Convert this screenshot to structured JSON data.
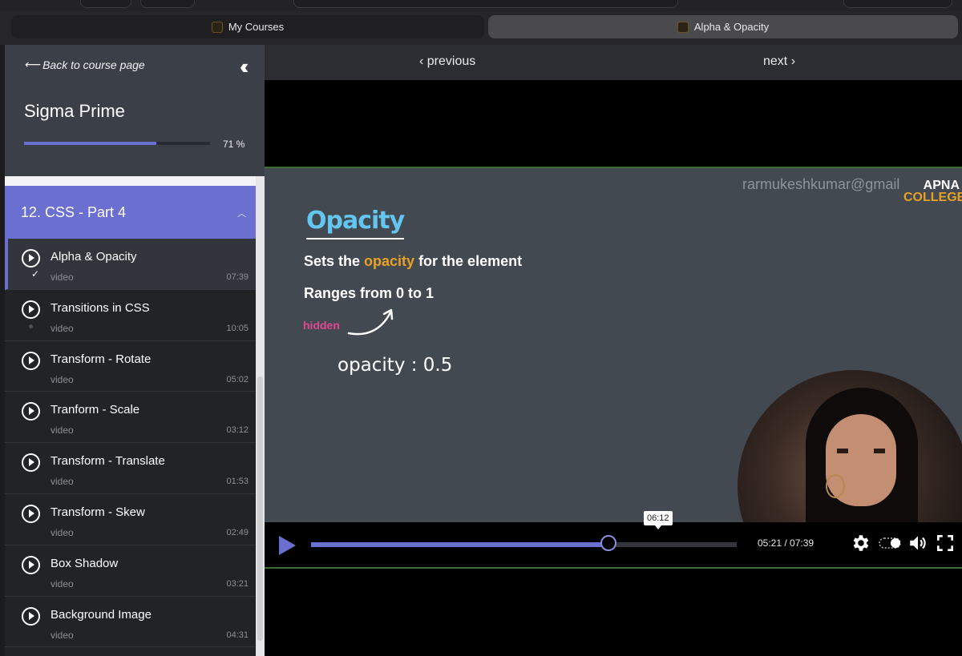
{
  "tabs": [
    {
      "label": "My Courses",
      "active": false
    },
    {
      "label": "Alpha & Opacity",
      "active": true
    }
  ],
  "sidebar": {
    "back_label": "Back to course page",
    "collapse_icon": "double-chevron-left-icon",
    "course_title": "Sigma Prime",
    "progress_percent": 71,
    "progress_label": "71 %",
    "section_title": "12. CSS - Part 4",
    "lessons": [
      {
        "title": "Alpha & Opacity",
        "type": "video",
        "duration": "07:39",
        "status": "completed",
        "current": true
      },
      {
        "title": "Transitions in CSS",
        "type": "video",
        "duration": "10:05",
        "status": "in-progress",
        "current": false
      },
      {
        "title": "Transform - Rotate",
        "type": "video",
        "duration": "05:02",
        "status": "",
        "current": false
      },
      {
        "title": "Tranform - Scale",
        "type": "video",
        "duration": "03:12",
        "status": "",
        "current": false
      },
      {
        "title": "Transform - Translate",
        "type": "video",
        "duration": "01:53",
        "status": "",
        "current": false
      },
      {
        "title": "Transform - Skew",
        "type": "video",
        "duration": "02:49",
        "status": "",
        "current": false
      },
      {
        "title": "Box Shadow",
        "type": "video",
        "duration": "03:21",
        "status": "",
        "current": false
      },
      {
        "title": "Background Image",
        "type": "video",
        "duration": "04:31",
        "status": "",
        "current": false
      }
    ]
  },
  "nav": {
    "previous_label": "‹ previous",
    "next_label": "next ›"
  },
  "slide": {
    "watermark": "rarmukeshkumar@gmail",
    "logo_line1": "APNA",
    "logo_line2": "COLLEGE",
    "title": "Opacity",
    "line1_before": "Sets the ",
    "line1_highlight": "opacity",
    "line1_after": " for the element",
    "line2": "Ranges from 0 to 1",
    "hidden_label": "hidden",
    "code": "opacity : 0.5"
  },
  "player": {
    "played_fraction": 0.6986,
    "hover_time": "06:12",
    "time_display": "05:21 / 07:39",
    "icons": [
      "play-icon",
      "settings-gear-icon",
      "toggle-icon",
      "volume-icon",
      "fullscreen-icon"
    ]
  },
  "colors": {
    "accent": "#6b6fcf",
    "highlight": "#e8a125",
    "slide_title": "#63c6f0",
    "hidden_text": "#e0478f"
  }
}
